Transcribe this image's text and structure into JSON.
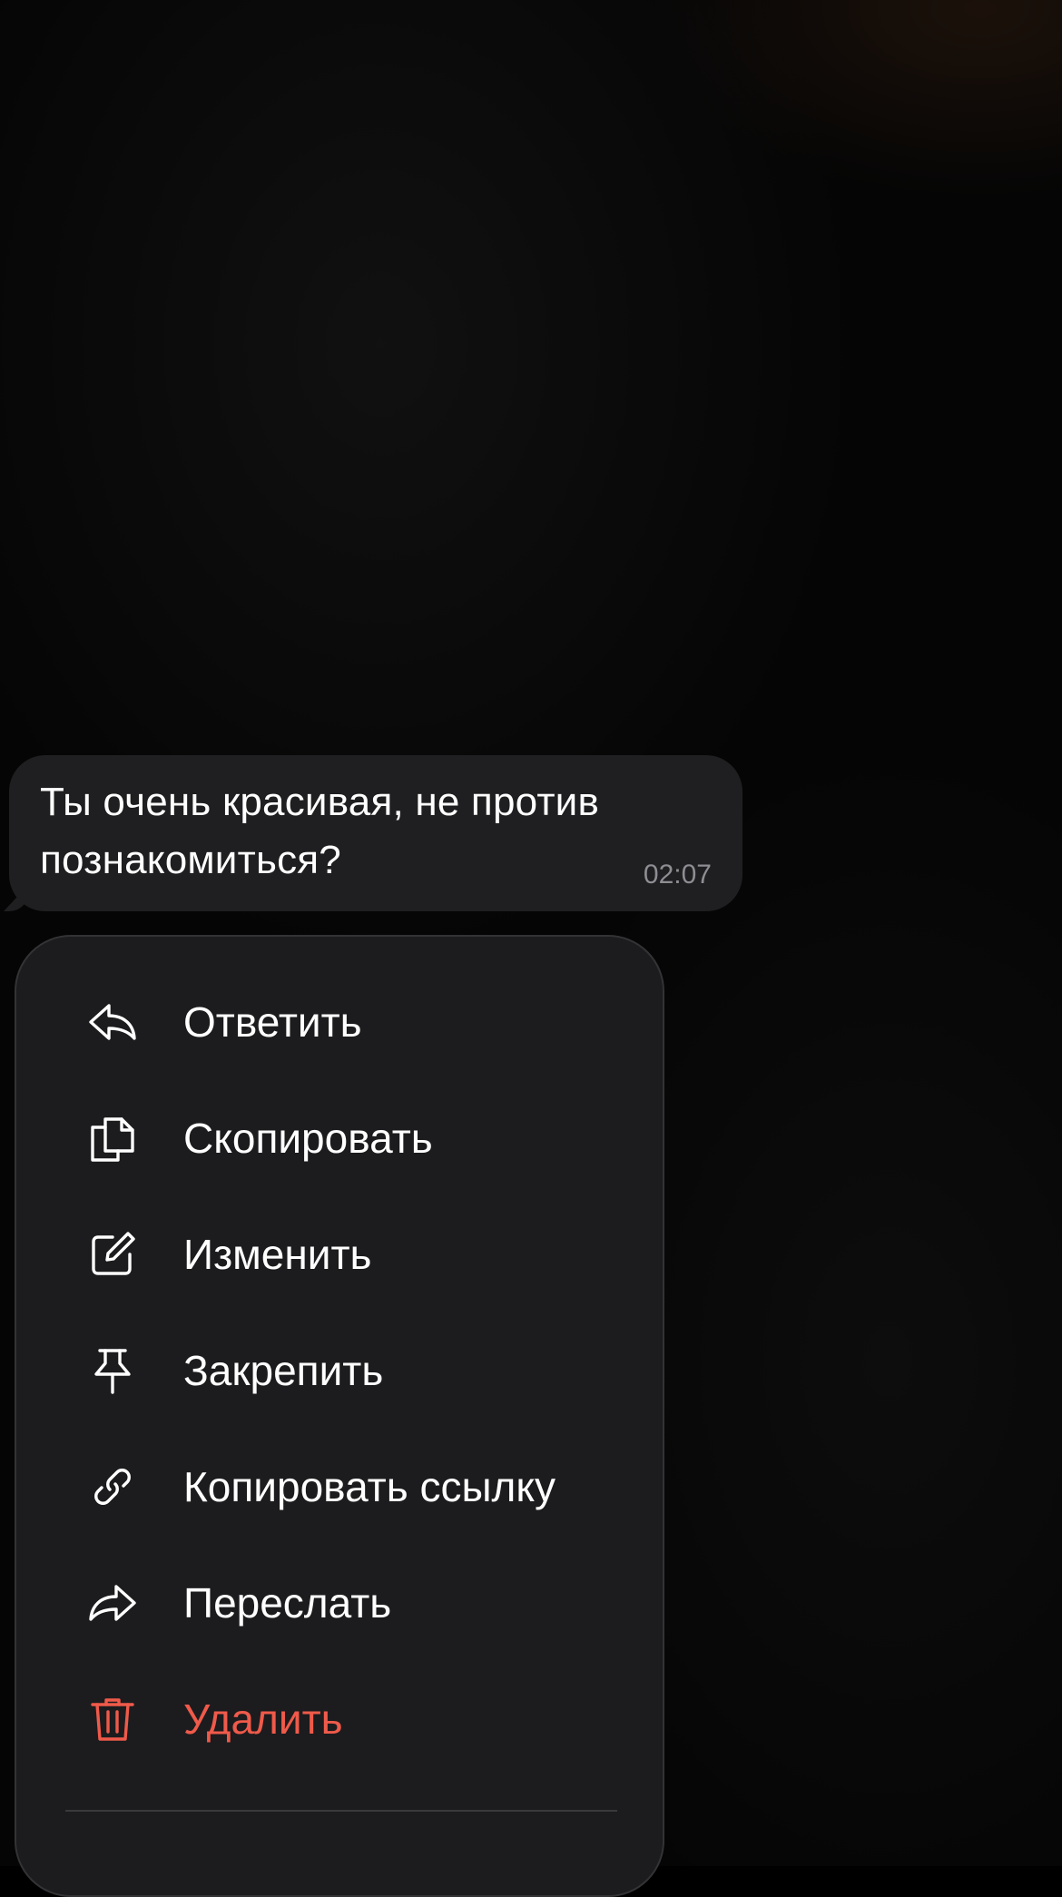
{
  "message": {
    "text": "Ты очень красивая, не против познакомиться?",
    "time": "02:07"
  },
  "context_menu": {
    "items": [
      {
        "label": "Ответить",
        "icon": "reply-icon"
      },
      {
        "label": "Скопировать",
        "icon": "copy-icon"
      },
      {
        "label": "Изменить",
        "icon": "edit-icon"
      },
      {
        "label": "Закрепить",
        "icon": "pin-icon"
      },
      {
        "label": "Копировать ссылку",
        "icon": "link-icon"
      },
      {
        "label": "Переслать",
        "icon": "forward-icon"
      },
      {
        "label": "Удалить",
        "icon": "trash-icon"
      }
    ]
  },
  "colors": {
    "background": "#000000",
    "bubble": "#1f1f21",
    "menu": "#1c1c1e",
    "text": "#ffffff",
    "timestamp": "#8d8d92",
    "danger": "#ef5a4a"
  }
}
